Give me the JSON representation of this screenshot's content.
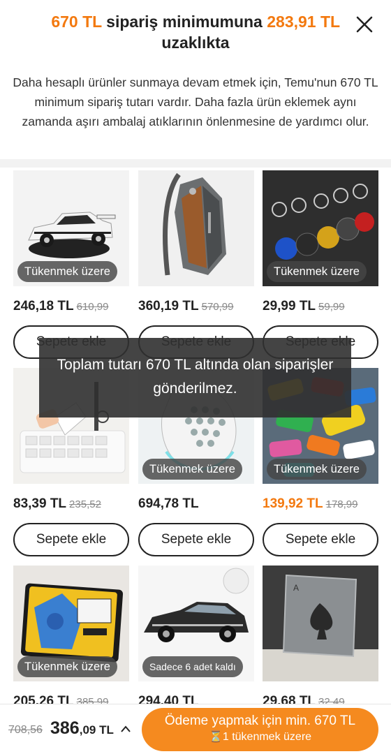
{
  "header": {
    "amount": "670 TL",
    "title_middle": " sipariş minimumuna ",
    "remaining_amount": "283,91 TL",
    "title_end": " uzaklıkta",
    "description": "Daha hesaplı ürünler sunmaya devam etmek için, Temu'nun 670 TL minimum sipariş tutarı vardır.   Daha fazla ürün eklemek aynı zamanda aşırı ambalaj atıklarının önlenmesine de yardımcı olur."
  },
  "products": [
    {
      "badge": "Tükenmek üzere",
      "price": "246,18 TL",
      "old_price": "610,99",
      "button": "Sepete ekle"
    },
    {
      "badge": "",
      "price": "360,19 TL",
      "old_price": "570,99",
      "button": "Sepete ekle"
    },
    {
      "badge": "Tükenmek üzere",
      "price": "29,99 TL",
      "old_price": "59,99",
      "button": "Sepete ekle"
    },
    {
      "badge": "",
      "price": "83,39 TL",
      "old_price": "235,52",
      "button": "Sepete ekle"
    },
    {
      "badge": "Tükenmek üzere",
      "price": "694,78 TL",
      "old_price": "",
      "button": "Sepete ekle"
    },
    {
      "badge": "Tükenmek üzere",
      "price": "139,92 TL",
      "old_price": "178,99",
      "button": "Sepete ekle"
    },
    {
      "badge": "Tükenmek üzere",
      "price": "205,26 TL",
      "old_price": "385,99",
      "button": ""
    },
    {
      "badge": "Sadece 6 adet kaldı",
      "price": "294,40 TL",
      "old_price": "",
      "button": ""
    },
    {
      "badge": "",
      "price": "29,68 TL",
      "old_price": "32,49",
      "button": ""
    }
  ],
  "toast": {
    "message": "Toplam tutarı 670 TL altında olan siparişler gönderilmez."
  },
  "footer": {
    "old_total": "708,56",
    "total_int": "386",
    "total_dec": ",09 TL",
    "checkout_label": "Ödeme yapmak için min. 670 TL",
    "checkout_sub": "⏳1 tükenmek üzere"
  },
  "colors": {
    "accent": "#f3790f",
    "checkout_bg": "#f58a1f"
  },
  "icons": {
    "close": "close-icon",
    "chevron": "chevron-up-icon",
    "hourglass": "hourglass-icon"
  }
}
